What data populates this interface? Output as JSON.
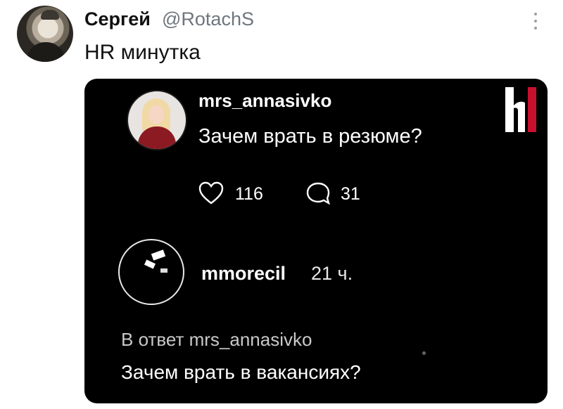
{
  "tweet": {
    "author_name": "Сергей",
    "author_handle": "@RotachS",
    "text": "HR минутка"
  },
  "media": {
    "post": {
      "author": "mrs_annasivko",
      "text": "Зачем врать в резюме?",
      "likes": "116",
      "comments": "31"
    },
    "logo_letter": "h",
    "reply": {
      "author": "mmorecil",
      "time": "21 ч.",
      "reply_to": "В ответ mrs_annasivko",
      "text": "Зачем врать в вакансиях?"
    }
  },
  "colors": {
    "media_background": "#000000",
    "handle_gray": "#6e767d",
    "logo_red": "#c8102e"
  },
  "icons": [
    "more-vertical-icon",
    "heart-icon",
    "comment-bubble-icon",
    "hh-logo-icon"
  ]
}
